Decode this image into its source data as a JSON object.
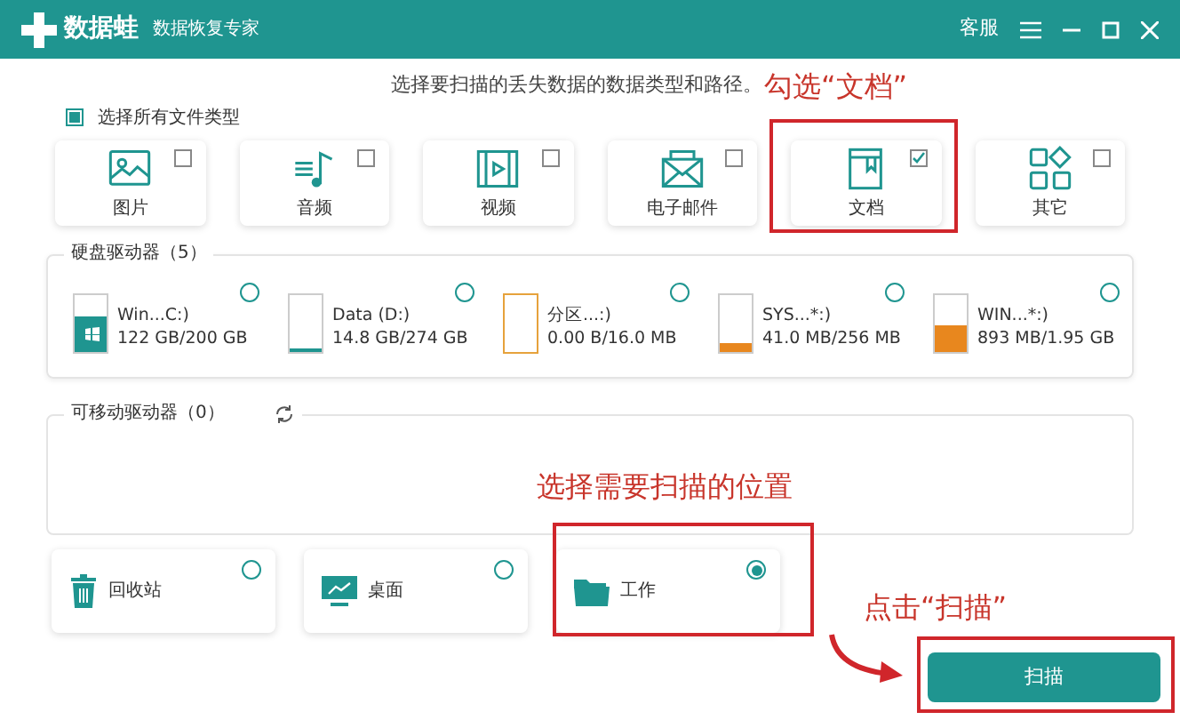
{
  "window": {
    "app_name": "数据蛙",
    "subtitle": "数据恢复专家",
    "support": "客服"
  },
  "heading": "选择要扫描的丢失数据的数据类型和路径。",
  "select_all": {
    "label": "选择所有文件类型",
    "checked": true
  },
  "file_types": [
    {
      "kind": "image",
      "label": "图片",
      "checked": false
    },
    {
      "kind": "audio",
      "label": "音频",
      "checked": false
    },
    {
      "kind": "video",
      "label": "视频",
      "checked": false
    },
    {
      "kind": "email",
      "label": "电子邮件",
      "checked": false
    },
    {
      "kind": "document",
      "label": "文档",
      "checked": true
    },
    {
      "kind": "other",
      "label": "其它",
      "checked": false
    }
  ],
  "hard_drives": {
    "title": "硬盘驱动器（5）",
    "drives": [
      {
        "name": "Win...C:)",
        "usage": "122 GB/200 GB",
        "level": 0.61,
        "color": "#1f9590",
        "system": true,
        "selected": false
      },
      {
        "name": "Data (D:)",
        "usage": "14.8 GB/274 GB",
        "level": 0.05,
        "color": "#1f9590",
        "system": false,
        "selected": false
      },
      {
        "name": "分区...:)",
        "usage": "0.00  B/16.0 MB",
        "level": 0,
        "color": "#e6a23c",
        "system": false,
        "selected": false
      },
      {
        "name": "SYS...*:)",
        "usage": "41.0 MB/256 MB",
        "level": 0.16,
        "color": "#e8871e",
        "system": false,
        "selected": false
      },
      {
        "name": "WIN...*:)",
        "usage": "893 MB/1.95 GB",
        "level": 0.46,
        "color": "#e8871e",
        "system": false,
        "selected": false
      }
    ]
  },
  "removable_drives": {
    "title": "可移动驱动器（0）"
  },
  "locations": [
    {
      "kind": "recycle",
      "label": "回收站",
      "selected": false
    },
    {
      "kind": "desktop",
      "label": "桌面",
      "selected": false
    },
    {
      "kind": "folder",
      "label": "工作",
      "selected": true
    }
  ],
  "scan_button": "扫描",
  "annotations": [
    {
      "text": "勾选“文档”"
    },
    {
      "text": "选择需要扫描的位置"
    },
    {
      "text": "点击“扫描”"
    }
  ]
}
